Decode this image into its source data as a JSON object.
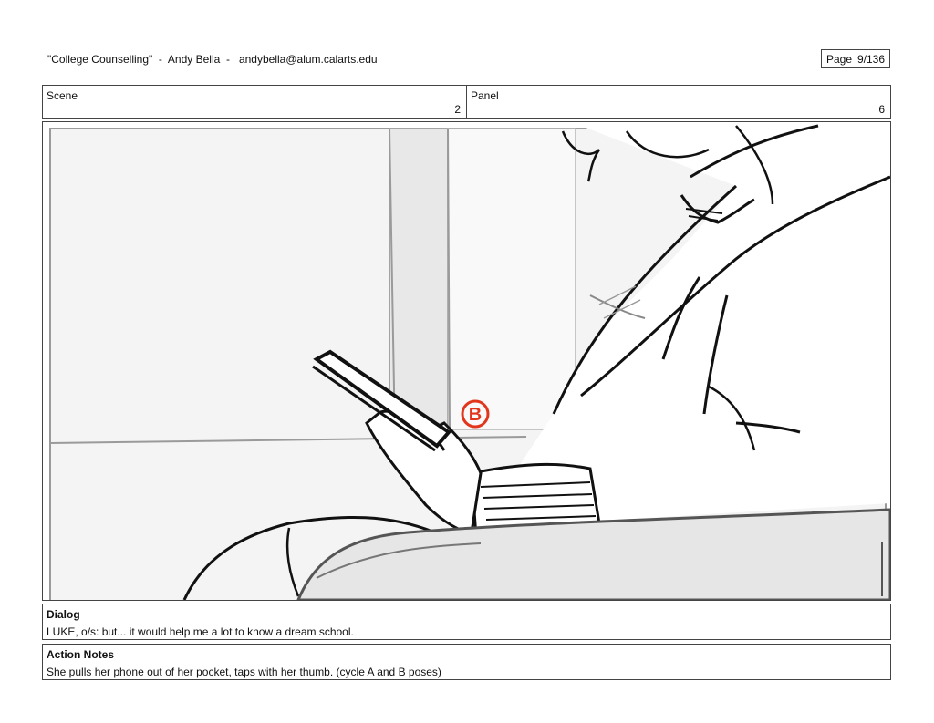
{
  "header": {
    "title": "\"College Counselling\"  -  Andy Bella  -   andybella@alum.calarts.edu",
    "page_label": "Page",
    "page_value": "9/136"
  },
  "info": {
    "scene_label": "Scene",
    "scene_value": "2",
    "panel_label": "Panel",
    "panel_value": "6"
  },
  "artwork": {
    "pose_marker": "B",
    "marker_color": "#e2361c"
  },
  "dialog": {
    "label": "Dialog",
    "text": "LUKE, o/s: but... it would help me a lot to know a dream school."
  },
  "action_notes": {
    "label": "Action Notes",
    "text": "She pulls her phone out of her pocket, taps with her thumb. (cycle A and B poses)"
  }
}
